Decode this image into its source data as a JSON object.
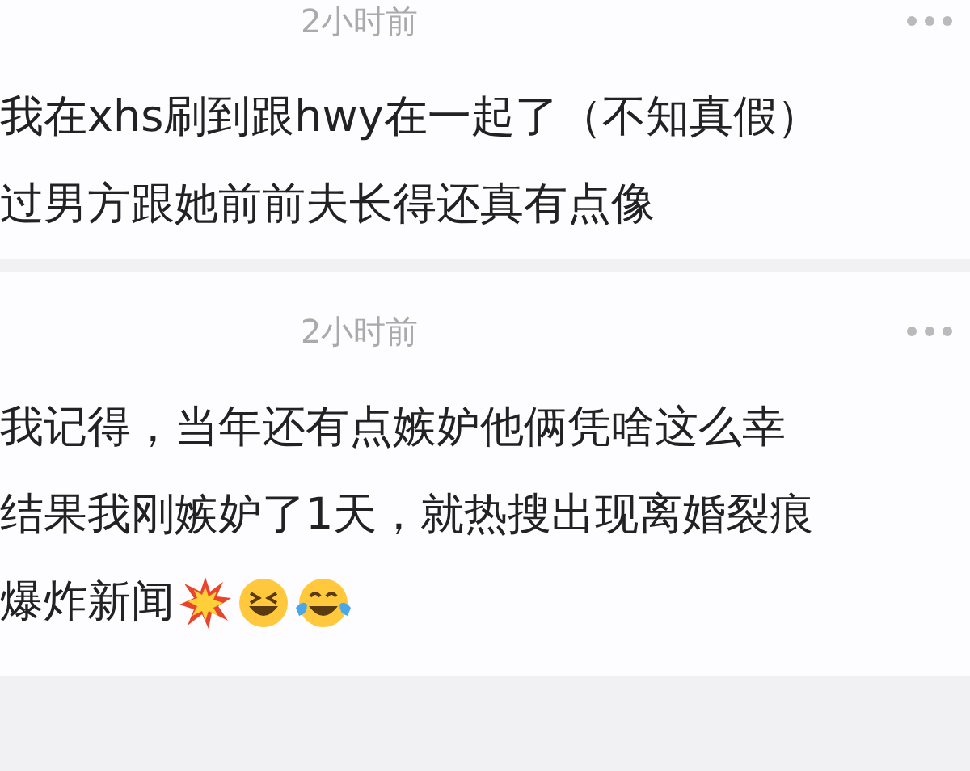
{
  "comments": [
    {
      "time": "2小时前",
      "lines": [
        {
          "text": "我在xhs刷到跟hwy在一起了（不知真假）"
        },
        {
          "text": "过男方跟她前前夫长得还真有点像"
        }
      ]
    },
    {
      "time": "2小时前",
      "lines": [
        {
          "text": "我记得，当年还有点嫉妒他俩凭啥这么幸"
        },
        {
          "text": "结果我刚嫉妒了1天，就热搜出现离婚裂痕"
        },
        {
          "text": "爆炸新闻",
          "emoji": [
            {
              "kind": "explosion"
            },
            {
              "kind": "grin"
            },
            {
              "kind": "tears"
            }
          ]
        }
      ]
    }
  ]
}
